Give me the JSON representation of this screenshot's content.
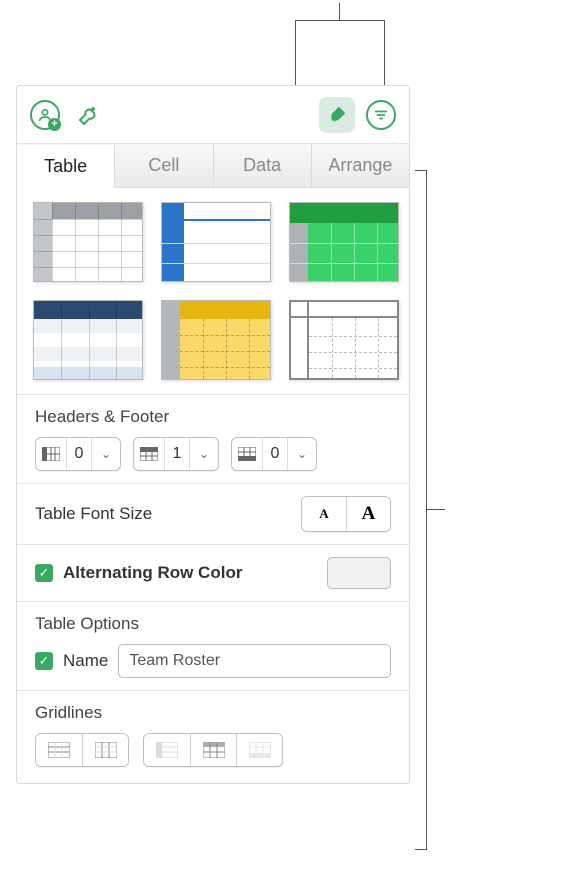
{
  "tabs": {
    "table": "Table",
    "cell": "Cell",
    "data": "Data",
    "arrange": "Arrange"
  },
  "sections": {
    "headers_footer_title": "Headers & Footer",
    "header_cols_value": "0",
    "header_rows_value": "1",
    "footer_rows_value": "0",
    "font_size_title": "Table Font Size",
    "alt_row_label": "Alternating Row Color",
    "table_options_title": "Table Options",
    "name_label": "Name",
    "name_value": "Team Roster",
    "gridlines_title": "Gridlines"
  }
}
